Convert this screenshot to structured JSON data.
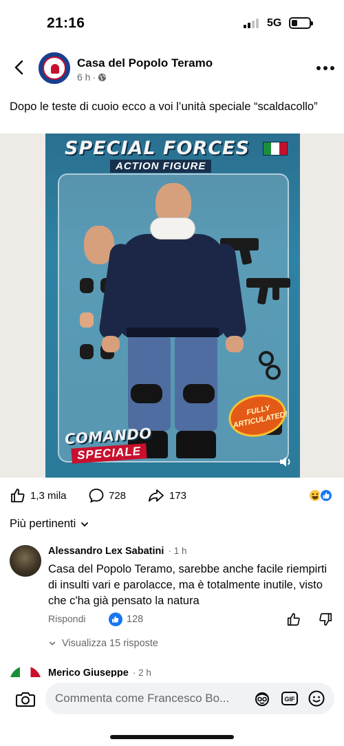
{
  "status_bar": {
    "time": "21:16",
    "network": "5G",
    "battery_level": 0.25,
    "signal_bars_filled": 2
  },
  "post": {
    "page_name": "Casa del Popolo Teramo",
    "time": "6 h",
    "audience_icon": "globe-icon",
    "caption": "Dopo le teste di cuoio ecco a voi l’unità speciale “scaldacollo”"
  },
  "image": {
    "title1": "SPECIAL FORCES",
    "title2": "ACTION FIGURE",
    "badge": [
      "FULLY",
      "ARTICULATED!"
    ],
    "comando": "COMANDO",
    "speciale": "SPECIALE",
    "flag_colors": [
      "#1a8f3a",
      "#ffffff",
      "#c8102e"
    ]
  },
  "reactions": {
    "likes": "1,3 mila",
    "comments": "728",
    "shares": "173"
  },
  "comments_sort": "Più pertinenti",
  "comment": {
    "author": "Alessandro Lex Sabatini",
    "time": "1 h",
    "text": "Casa del Popolo Teramo, sarebbe anche facile riempirti di insulti vari e parolacce, ma è totalmente inutile, visto che c'ha già pensato la natura",
    "reply_label": "Rispondi",
    "likes": "128",
    "view_replies": "Visualizza 15 risposte"
  },
  "comment2": {
    "author": "Merico Giuseppe",
    "time": "2 h"
  },
  "composer": {
    "placeholder": "Commenta come Francesco Bo..."
  },
  "colors": {
    "accent": "#1877f2",
    "secondary_text": "#65676b",
    "input_bg": "#f0f2f5"
  }
}
